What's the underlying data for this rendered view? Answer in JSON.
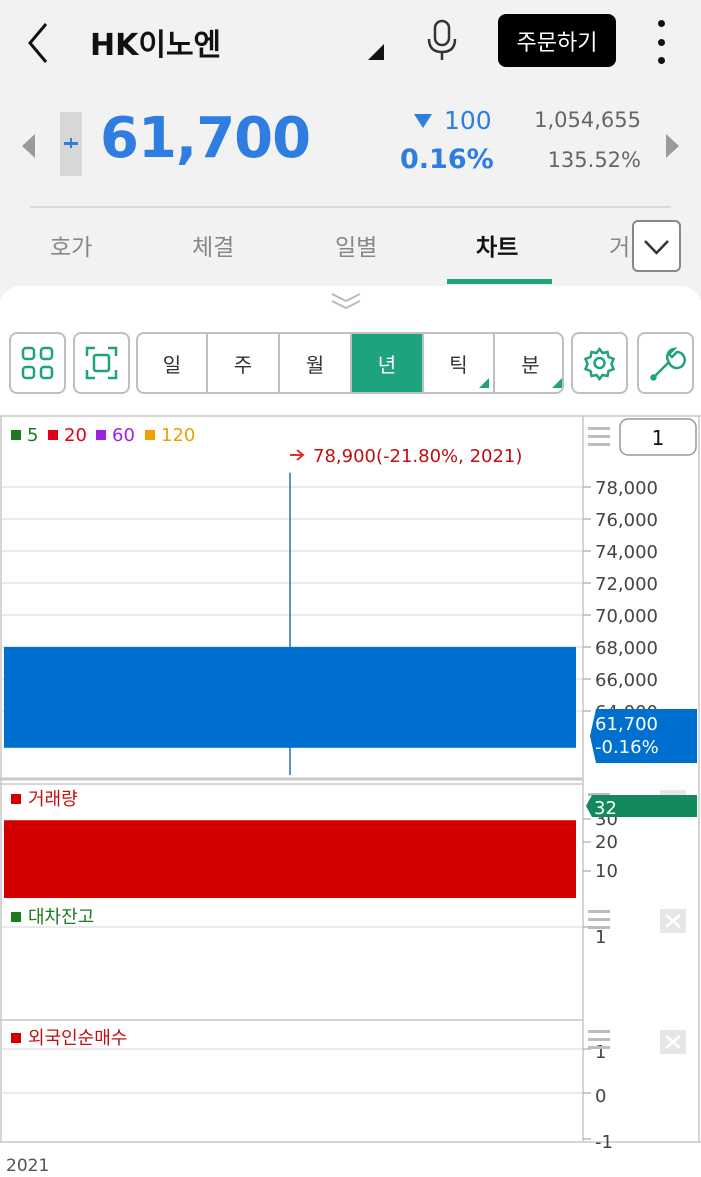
{
  "header": {
    "title": "HK이노엔",
    "order_button": "주문하기"
  },
  "quote": {
    "price": "61,700",
    "change": "100",
    "change_percent": "0.16%",
    "volume": "1,054,655",
    "volume_ratio": "135.52%"
  },
  "tabs": [
    {
      "label": "호가",
      "active": false
    },
    {
      "label": "체결",
      "active": false
    },
    {
      "label": "일별",
      "active": false
    },
    {
      "label": "차트",
      "active": true
    },
    {
      "label": "거",
      "active": false
    }
  ],
  "toolbar": {
    "periods": [
      {
        "label": "일",
        "active": false,
        "has_menu": false
      },
      {
        "label": "주",
        "active": false,
        "has_menu": false
      },
      {
        "label": "월",
        "active": false,
        "has_menu": false
      },
      {
        "label": "년",
        "active": true,
        "has_menu": false
      },
      {
        "label": "틱",
        "active": false,
        "has_menu": true
      },
      {
        "label": "분",
        "active": false,
        "has_menu": true
      }
    ],
    "count_value": "1"
  },
  "colors": {
    "accent": "#1fa27e",
    "down_blue": "#0070d0",
    "volume_red": "#d40000",
    "ma5": "#1e7a1e",
    "ma20": "#e0001a",
    "ma60": "#a020e0",
    "ma120": "#f0a000"
  },
  "chart_data": [
    {
      "type": "candlestick",
      "legend": [
        {
          "name": "5",
          "color": "#1e7a1e"
        },
        {
          "name": "20",
          "color": "#e0001a"
        },
        {
          "name": "60",
          "color": "#a020e0"
        },
        {
          "name": "120",
          "color": "#f0a000"
        }
      ],
      "candles": [
        {
          "x": "2021",
          "open": 68000,
          "high": 78900,
          "low": 60000,
          "close": 61700
        }
      ],
      "annotation": "78,900(-21.80%, 2021)",
      "y_ticks": [
        64000,
        66000,
        68000,
        70000,
        72000,
        74000,
        76000,
        78000
      ],
      "y_tick_labels": [
        "64,000",
        "66,000",
        "68,000",
        "70,000",
        "72,000",
        "74,000",
        "76,000",
        "78,000"
      ],
      "ylim": [
        60000,
        80000
      ],
      "current_label": "61,700",
      "current_change": "-0.16%",
      "x_label": "2021"
    },
    {
      "type": "bar",
      "title": "거래량",
      "values": [
        32
      ],
      "y_ticks": [
        10,
        20,
        30
      ],
      "ylim": [
        0,
        37
      ],
      "current_label": "32"
    },
    {
      "type": "line",
      "title": "대차잔고",
      "y_ticks": [
        1
      ],
      "values": []
    },
    {
      "type": "line",
      "title": "외국인순매수",
      "y_ticks": [
        1,
        0,
        -1
      ],
      "ylim": [
        -1,
        1
      ],
      "values": []
    }
  ]
}
